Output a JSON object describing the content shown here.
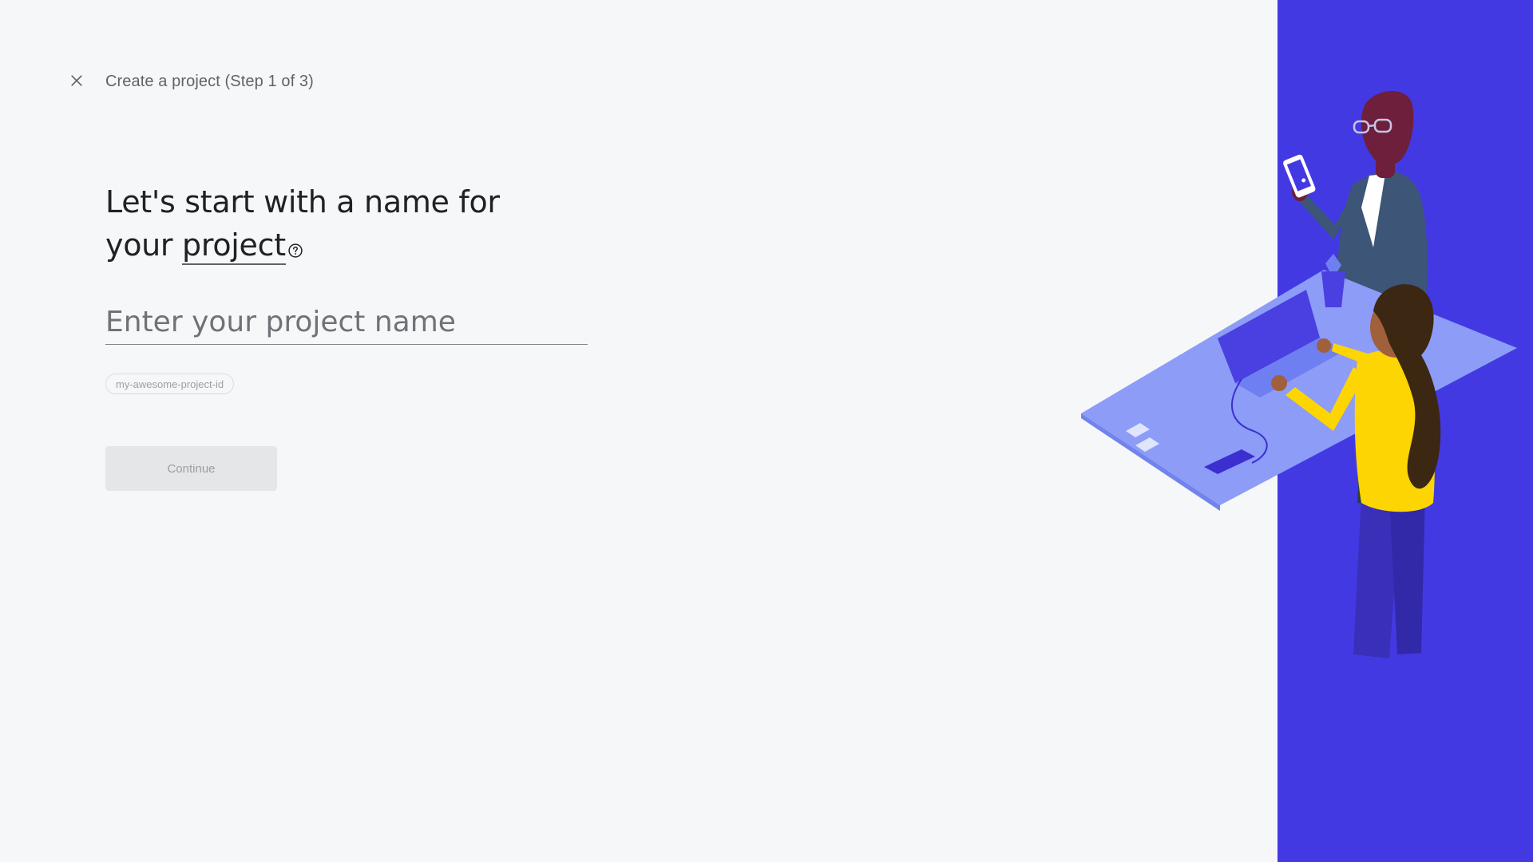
{
  "header": {
    "step_title": "Create a project (Step 1 of 3)",
    "close_icon": "close-icon"
  },
  "main": {
    "heading_line1": "Let's start with a name for",
    "heading_line2_prefix": "your ",
    "heading_line2_link": "project",
    "help_icon": "help-circle-icon",
    "name_input": {
      "placeholder": "Enter your project name",
      "value": ""
    },
    "project_id_chip": "my-awesome-project-id",
    "continue_label": "Continue"
  },
  "colors": {
    "background": "#f6f7f9",
    "panel_accent": "#4339e3",
    "desk": "#8c9cf7",
    "shirt": "#fcd502"
  }
}
